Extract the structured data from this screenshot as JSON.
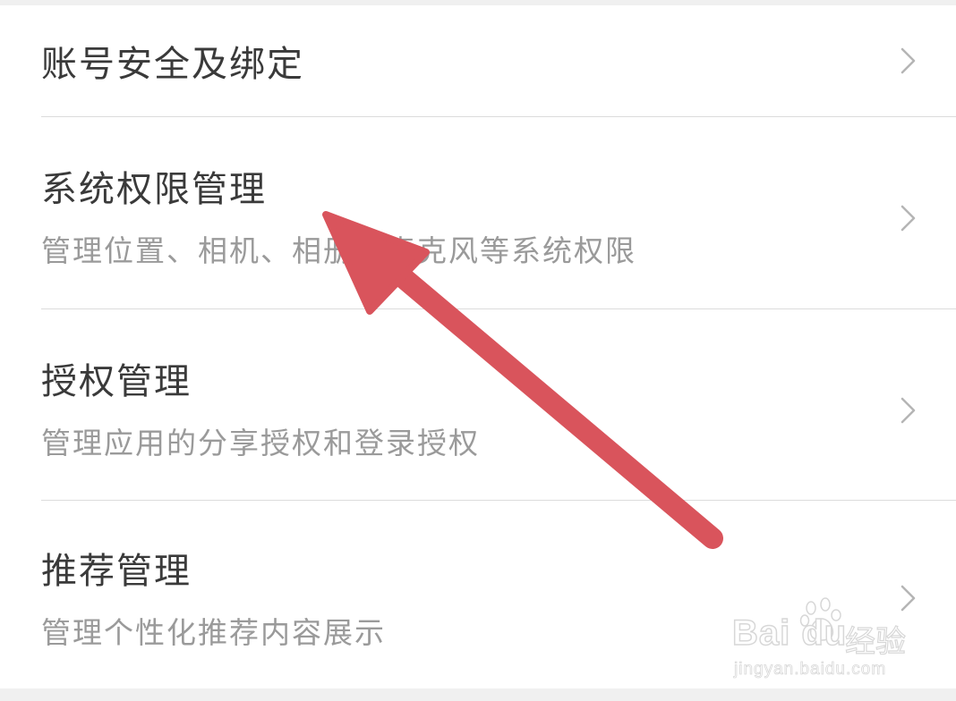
{
  "settings_list": {
    "items": [
      {
        "title": "账号安全及绑定",
        "subtitle": ""
      },
      {
        "title": "系统权限管理",
        "subtitle": "管理位置、相机、相册、麦克风等系统权限"
      },
      {
        "title": "授权管理",
        "subtitle": "管理应用的分享授权和登录授权"
      },
      {
        "title": "推荐管理",
        "subtitle": "管理个性化推荐内容展示"
      }
    ]
  },
  "annotation": {
    "arrow_color": "#d9545c"
  },
  "watermark": {
    "brand": "Bai du",
    "label": "经验",
    "url": "jingyan.baidu.com"
  },
  "colors": {
    "title": "#3a3a3a",
    "subtitle": "#9a9a9a",
    "divider": "#dcdcdc",
    "chevron": "#b5b5b5",
    "background": "#f2f2f2"
  },
  "icons": {
    "chevron": "chevron-right-icon",
    "paw": "baidu-paw-icon"
  }
}
